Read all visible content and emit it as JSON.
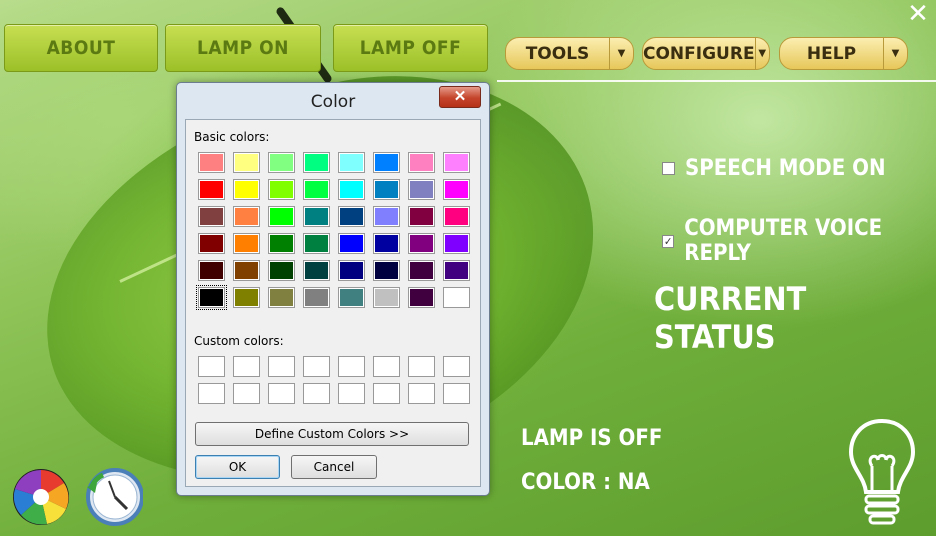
{
  "window": {
    "close_glyph": "✕"
  },
  "top_buttons": {
    "about": "ABOUT",
    "lamp_on": "LAMP ON",
    "lamp_off": "LAMP OFF"
  },
  "menus": [
    {
      "label": "TOOLS"
    },
    {
      "label": "CONFIGURE"
    },
    {
      "label": "HELP"
    }
  ],
  "options": {
    "speech_mode": {
      "label": "SPEECH MODE ON",
      "checked": false
    },
    "voice_reply": {
      "label": "COMPUTER VOICE REPLY",
      "checked": true
    }
  },
  "status": {
    "title": "CURRENT STATUS",
    "lamp": "LAMP IS OFF",
    "color": "COLOR : NA"
  },
  "dialog": {
    "title": "Color",
    "close_glyph": "✕",
    "basic_label": "Basic colors:",
    "custom_label": "Custom colors:",
    "define_button": "Define Custom Colors >>",
    "ok_button": "OK",
    "cancel_button": "Cancel",
    "selected_index": 40,
    "basic_colors": [
      "#ff8080",
      "#ffff80",
      "#80ff80",
      "#00ff80",
      "#80ffff",
      "#0080ff",
      "#ff80c0",
      "#ff80ff",
      "#ff0000",
      "#ffff00",
      "#80ff00",
      "#00ff40",
      "#00ffff",
      "#0080c0",
      "#8080c0",
      "#ff00ff",
      "#804040",
      "#ff8040",
      "#00ff00",
      "#008080",
      "#004080",
      "#8080ff",
      "#800040",
      "#ff0080",
      "#800000",
      "#ff8000",
      "#008000",
      "#008040",
      "#0000ff",
      "#0000a0",
      "#800080",
      "#8000ff",
      "#400000",
      "#804000",
      "#004000",
      "#004040",
      "#000080",
      "#000040",
      "#400040",
      "#400080",
      "#000000",
      "#808000",
      "#808040",
      "#808080",
      "#408080",
      "#c0c0c0",
      "#400040",
      "#ffffff"
    ],
    "custom_colors": [
      "#ffffff",
      "#ffffff",
      "#ffffff",
      "#ffffff",
      "#ffffff",
      "#ffffff",
      "#ffffff",
      "#ffffff",
      "#ffffff",
      "#ffffff",
      "#ffffff",
      "#ffffff",
      "#ffffff",
      "#ffffff",
      "#ffffff",
      "#ffffff"
    ]
  },
  "icons": {
    "close": "close-icon",
    "color_wheel": "color-wheel-icon",
    "clock": "alarm-clock-icon",
    "bulb": "light-bulb-icon",
    "dropdown": "chevron-down-icon"
  }
}
